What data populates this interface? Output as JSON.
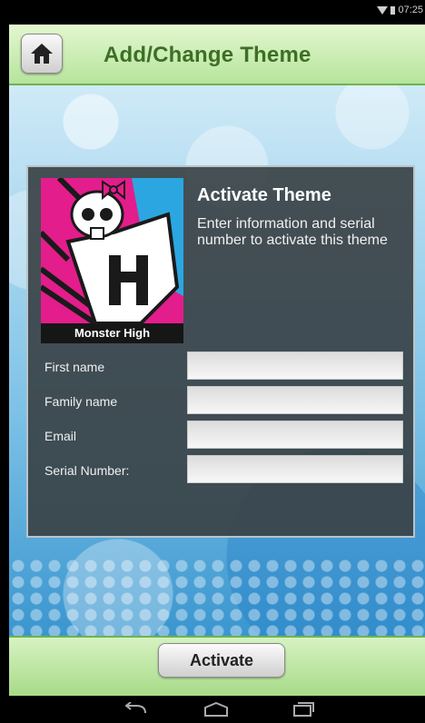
{
  "status_bar": {
    "time": "07:25"
  },
  "header": {
    "title": "Add/Change Theme"
  },
  "theme": {
    "name": "Monster High"
  },
  "panel": {
    "title": "Activate Theme",
    "description": "Enter information and serial number to activate this theme"
  },
  "form": {
    "first_name": {
      "label": "First name",
      "value": ""
    },
    "family_name": {
      "label": "Family name",
      "value": ""
    },
    "email": {
      "label": "Email",
      "value": ""
    },
    "serial": {
      "label": "Serial Number:",
      "value": ""
    }
  },
  "footer": {
    "activate_label": "Activate"
  },
  "icons": {
    "home": "home-icon",
    "wifi": "wifi-icon",
    "battery": "battery-icon",
    "back": "back-icon",
    "home_nav": "home-nav-icon",
    "recents": "recents-icon"
  },
  "colors": {
    "header_green": "#b6e49c",
    "title_green": "#3d6f25",
    "panel_dark": "#3a4246",
    "theme_pink": "#e31d8b"
  }
}
